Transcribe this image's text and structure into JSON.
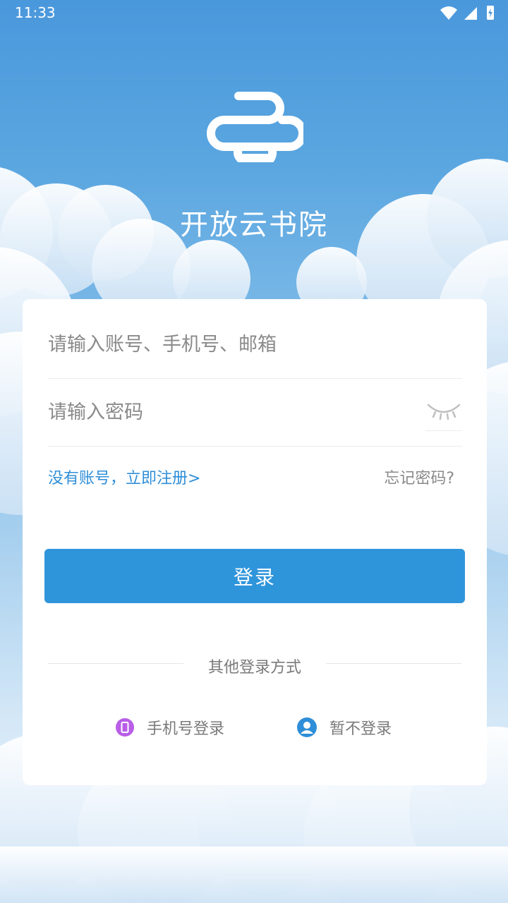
{
  "status_bar": {
    "time": "11:33"
  },
  "app": {
    "name": "开放云书院"
  },
  "login_form": {
    "account_placeholder": "请输入账号、手机号、邮箱",
    "password_placeholder": "请输入密码",
    "register_link": "没有账号，立即注册>",
    "forgot_link": "忘记密码?",
    "login_button": "登录"
  },
  "other_login": {
    "label": "其他登录方式",
    "options": [
      {
        "label": "手机号登录",
        "icon": "phone-icon"
      },
      {
        "label": "暂不登录",
        "icon": "user-icon"
      }
    ]
  },
  "colors": {
    "accent": "#2f95db",
    "link": "#2f8ed8",
    "phone_icon": "#b95ee8"
  }
}
